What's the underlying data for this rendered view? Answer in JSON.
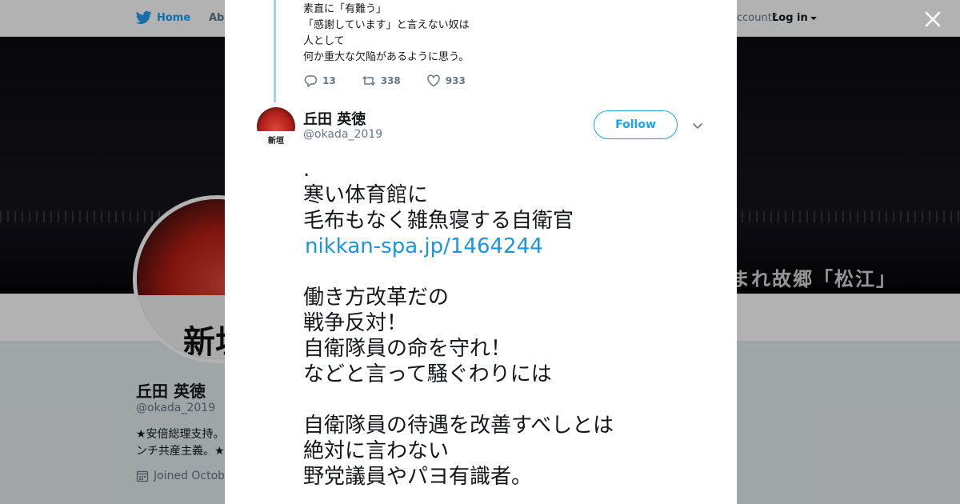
{
  "topbar": {
    "home_label": "Home",
    "about_label": "Abo",
    "account_prompt": "ccount?",
    "login_label": "Log in"
  },
  "banner": {
    "caption": "まれ故郷「松江」"
  },
  "profile": {
    "avatar_text": "新垣",
    "name": "丘田 英徳",
    "handle": "@okada_2019",
    "bio": "★安倍総理支持。\nンチ共産主義。★",
    "joined": "Joined Octobe"
  },
  "parent_tweet": {
    "text": "素直に「有難う」\n「感謝しています」と言えない奴は\n人として\n何か重大な欠陥があるように思う。",
    "replies": "13",
    "retweets": "338",
    "likes": "933"
  },
  "tweet": {
    "avatar_text": "新垣",
    "author_name": "丘田 英徳",
    "author_handle": "@okada_2019",
    "follow_label": "Follow",
    "lines": [
      ".",
      "寒い体育館に",
      "毛布もなく雑魚寝する自衛官",
      "",
      "",
      "働き方改革だの",
      "戦争反対！",
      "自衛隊員の命を守れ！",
      "などと言って騒ぐわりには",
      "",
      "自衛隊員の待遇を改善すべしとは",
      "絶対に言わない",
      "野党議員やパヨ有識者。"
    ],
    "link": "nikkan-spa.jp/1464244"
  },
  "colors": {
    "brand_blue": "#1da1f2",
    "link_blue": "#1b95e0",
    "text_primary": "#14171a",
    "text_secondary": "#657786",
    "conversation_line": "#9bd4f7"
  }
}
